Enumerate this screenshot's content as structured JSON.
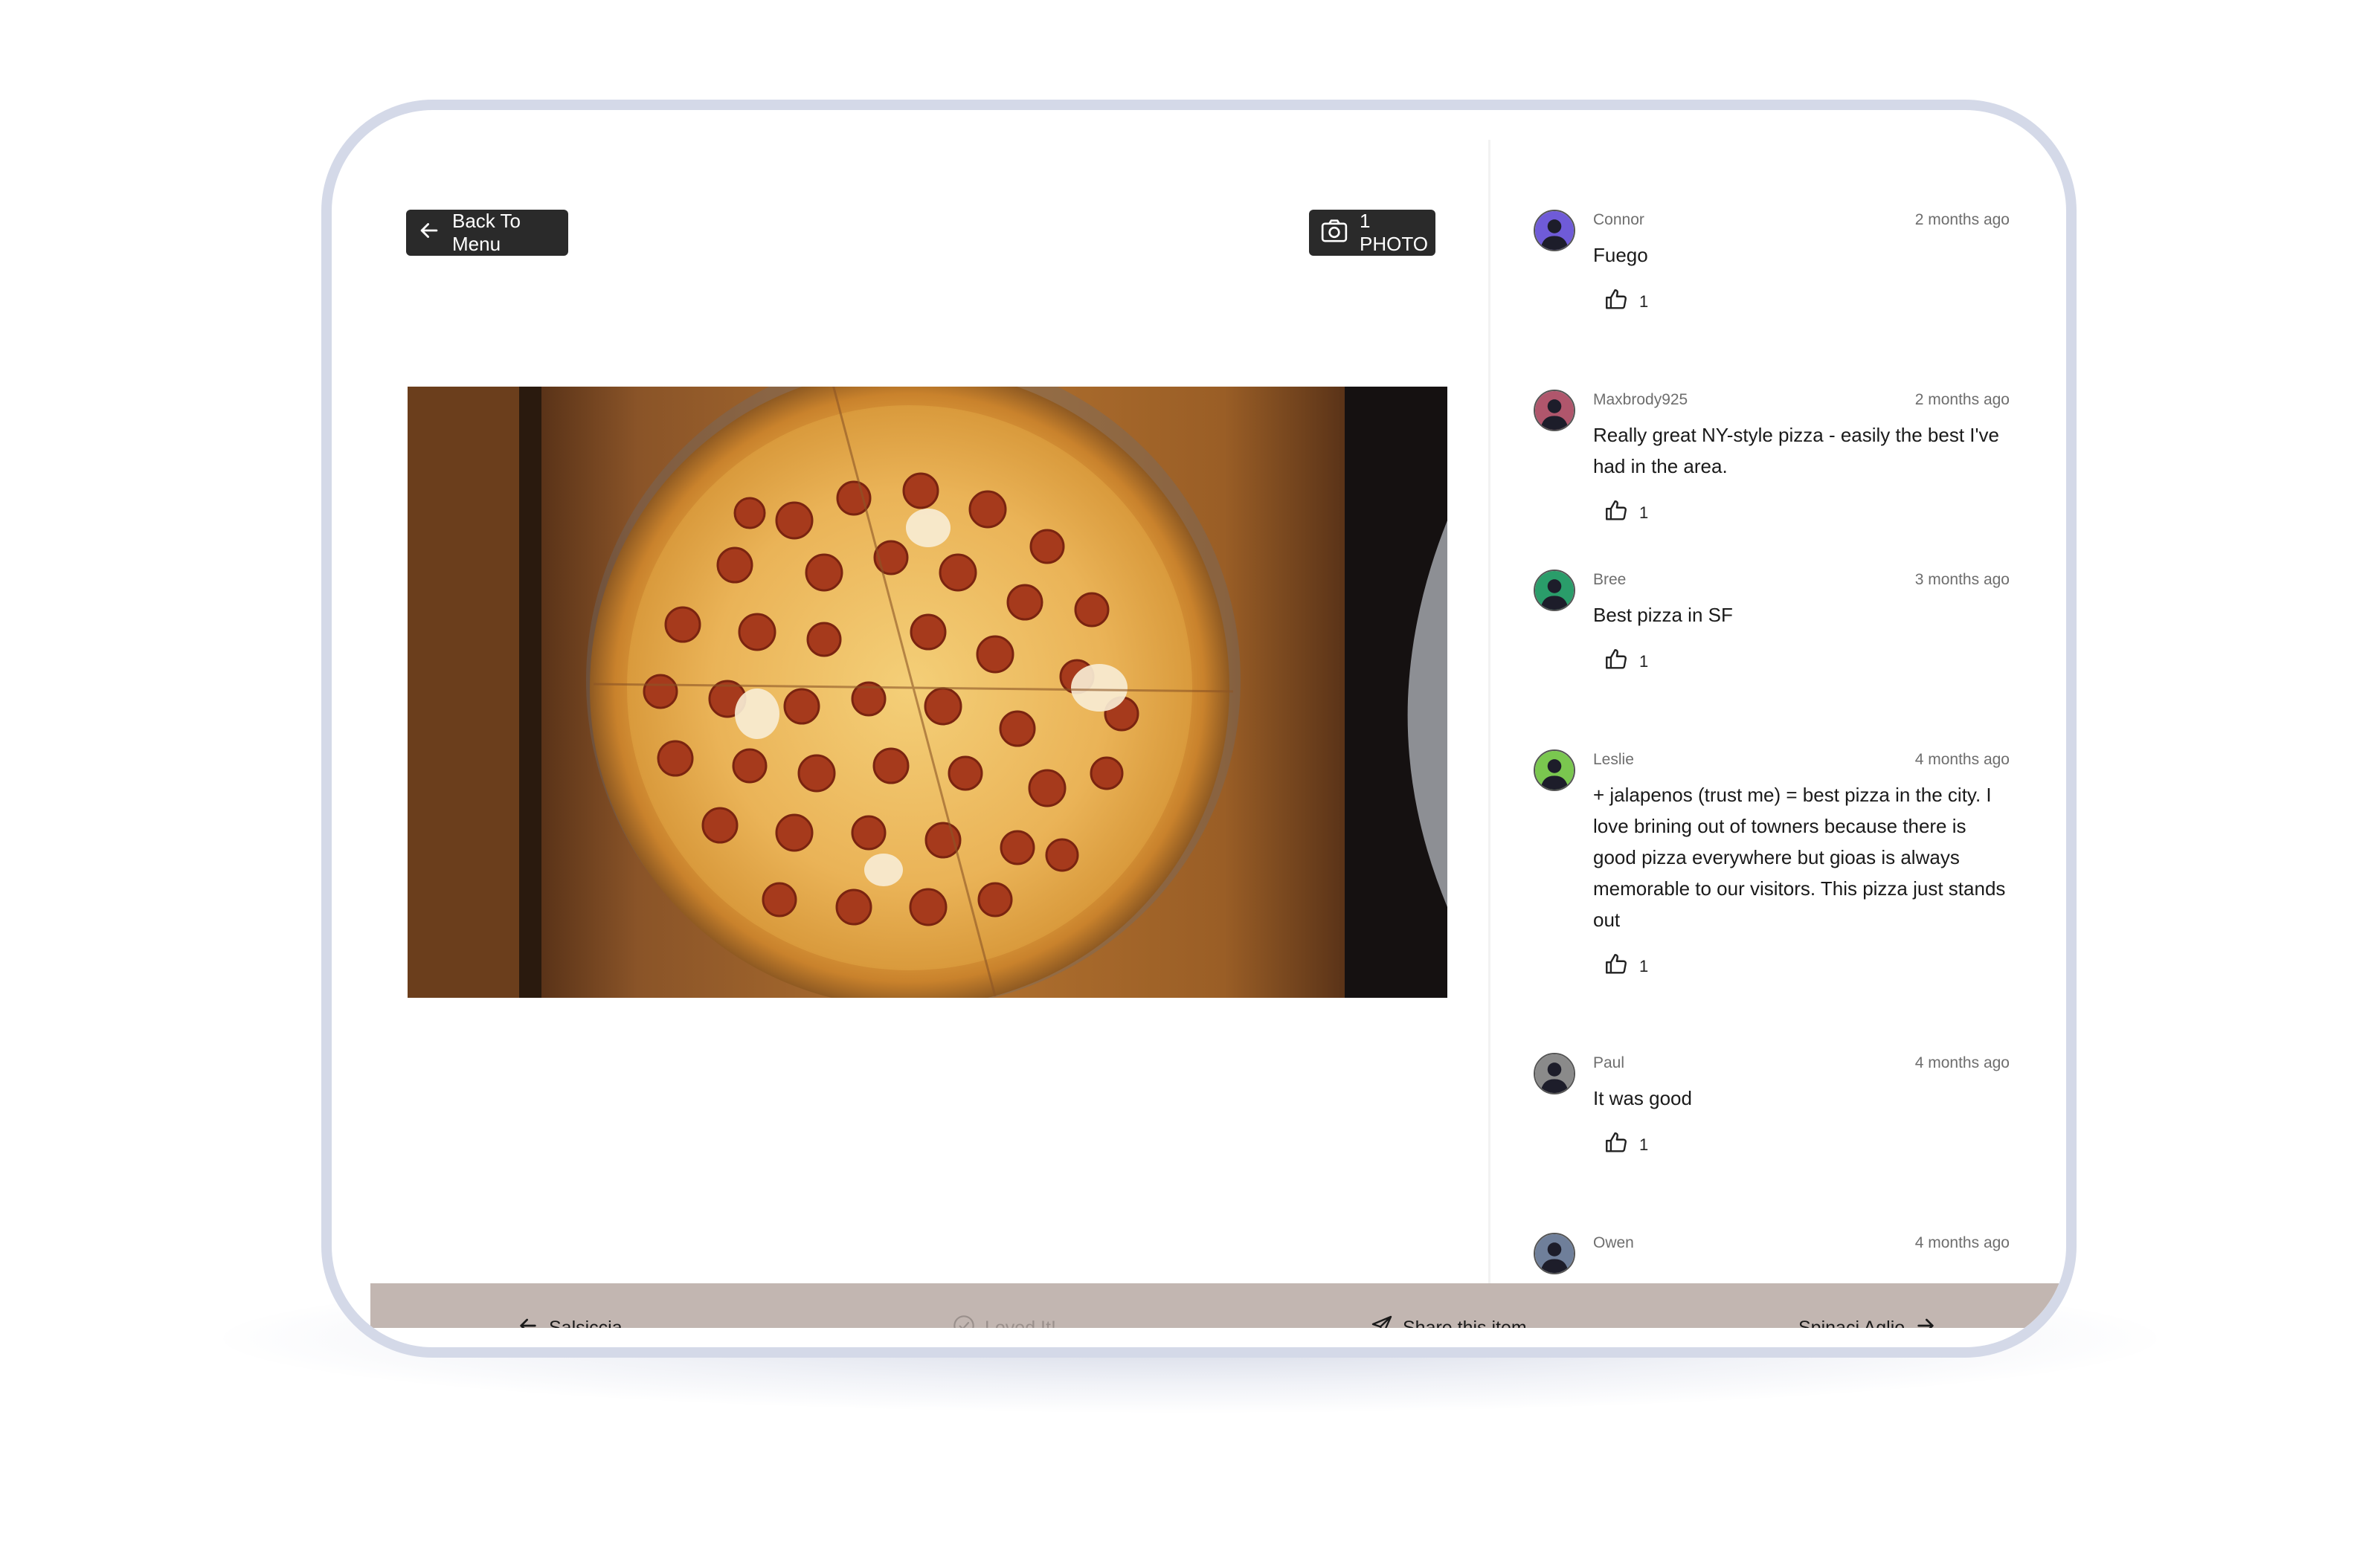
{
  "header": {
    "back_label": "Back To Menu",
    "photo_label": "1 PHOTO"
  },
  "photo": {
    "subject": "pepperoni-pizza"
  },
  "comments": [
    {
      "user": "Connor",
      "time": "2 months ago",
      "text": "Fuego",
      "likes": "1",
      "avatar_color": "#6f5bd8"
    },
    {
      "user": "Maxbrody925",
      "time": "2 months ago",
      "text": "Really great NY-style pizza - easily the best I've had in the area.",
      "likes": "1",
      "avatar_color": "#b0566c"
    },
    {
      "user": "Bree",
      "time": "3 months ago",
      "text": "Best pizza in SF",
      "likes": "1",
      "avatar_color": "#2a9d6a"
    },
    {
      "user": "Leslie",
      "time": "4 months ago",
      "text": "+ jalapenos (trust me) = best pizza in the city. I love brining out of towners because there is good pizza everywhere but gioas is always memorable to our visitors. This pizza just stands out",
      "likes": "1",
      "avatar_color": "#7ac74f"
    },
    {
      "user": "Paul",
      "time": "4 months ago",
      "text": "It was good",
      "likes": "1",
      "avatar_color": "#8a8a8a"
    },
    {
      "user": "Owen",
      "time": "4 months ago",
      "text": "",
      "likes": "",
      "avatar_color": "#6f7f9a"
    }
  ],
  "bottom_bar": {
    "prev_label": "Salsiccia",
    "loved_label": "Loved It!",
    "share_label": "Share this item",
    "next_label": "Spinaci Aglio"
  },
  "colors": {
    "bottom_bar": "#c2b6b1",
    "button_dark": "#2a2a2a",
    "device_frame": "#d4d9e8"
  }
}
